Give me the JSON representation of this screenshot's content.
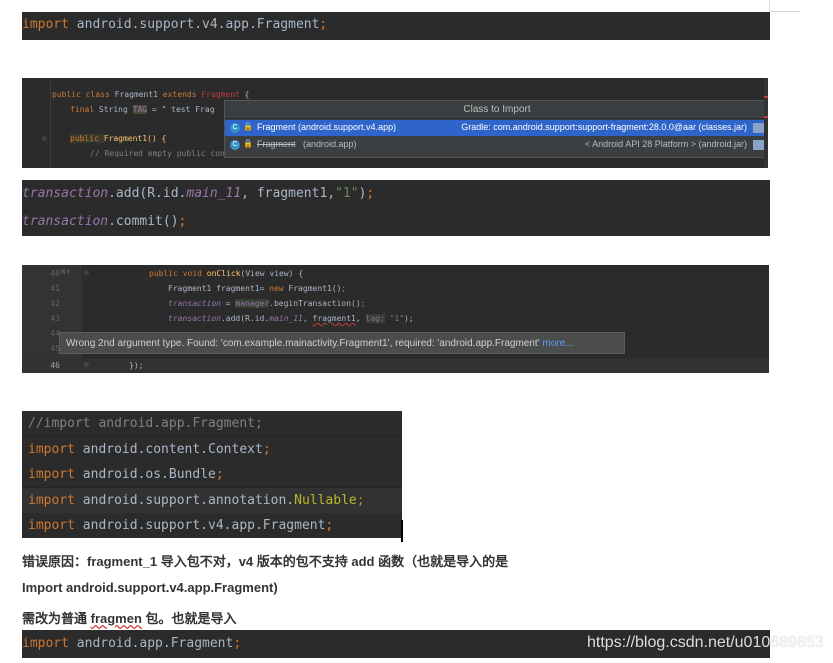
{
  "block1": {
    "kw": "import",
    "rest": " android.support.v4.app.Fragment",
    "semi": ";"
  },
  "block2": {
    "line1_kw": "public class ",
    "line1_name": "Fragment1 ",
    "line1_ext": "extends ",
    "line1_base": "Fragment",
    "line1_brace": " {",
    "line2_kw": "final ",
    "line2_rest": "String ",
    "line2_tag": "TAG",
    "line2_eq": " = \" test  Frag",
    "line3_kw": "public ",
    "line3_rest": "Fragment1() {",
    "line4": "// Required empty public constructor",
    "popup_title": "Class to Import",
    "item1_name": "Fragment (android.support.v4.app)",
    "item1_src": "Gradle: com.android.support:support-fragment:28.0.0@aar (classes.jar)",
    "item2_name": "Fragment",
    "item2_pkg": " (android.app)",
    "item2_src": "< Android API 28 Platform > (android.jar)"
  },
  "block3": {
    "l1_a": "transaction",
    "l1_b": ".add(R.id.",
    "l1_c": "main_11",
    "l1_d": ", fragment1,",
    "l1_e": "\"1\"",
    "l1_f": ")",
    "l1_g": ";",
    "l2_a": "transaction",
    "l2_b": ".commit()",
    "l2_c": ";"
  },
  "block4": {
    "lines": [
      "40",
      "41",
      "42",
      "43",
      "44",
      "45",
      "46"
    ],
    "c40_kw": "public void ",
    "c40_name": "onClick",
    "c40_rest": "(View view) {",
    "c41_a": "Fragment1 fragment1= ",
    "c41_kw": "new ",
    "c41_b": "Fragment1()",
    "c42_a": "transaction",
    "c42_b": " = ",
    "c42_c": "manager",
    "c42_d": ".beginTransaction()",
    "c43_a": "transaction",
    "c43_b": ".add(R.id.",
    "c43_c": "main_11",
    "c43_d": ", ",
    "c43_e": "fragment1",
    "c43_f": ", ",
    "c43_tag": "tag:",
    "c43_str": " \"1\"",
    "c43_end": ");",
    "c46": "});",
    "tooltip": "Wrong 2nd argument type. Found: 'com.example.mainactivity.Fragment1', required: 'android.app.Fragment'",
    "tooltip_more": "more..."
  },
  "block5": {
    "l1": "//import android.app.Fragment;",
    "l2_kw": "import",
    "l2_rest": " android.content.Context",
    "l2_semi": ";",
    "l3_kw": "import",
    "l3_rest": " android.os.Bundle",
    "l3_semi": ";",
    "l4_kw": "import",
    "l4_rest": " android.support.annotation.",
    "l4_ann": "Nullable",
    "l4_semi": ";",
    "l5_kw": "import",
    "l5_rest": " android.support.v4.app.Fragment",
    "l5_semi": ";"
  },
  "text": {
    "p1": "错误原因：fragment_1 导入包不对，v4 版本的包不支持 add 函数（也就是导入的是",
    "p2": "Import android.support.v4.app.Fragment)",
    "p3_a": "需改为普通 ",
    "p3_b": "fragmen",
    "p3_c": " 包。也就是导入"
  },
  "block6": {
    "kw": "import",
    "rest": " android.app.Fragment",
    "semi": ";"
  },
  "watermark": "https://blog.csdn.net/u010689853"
}
